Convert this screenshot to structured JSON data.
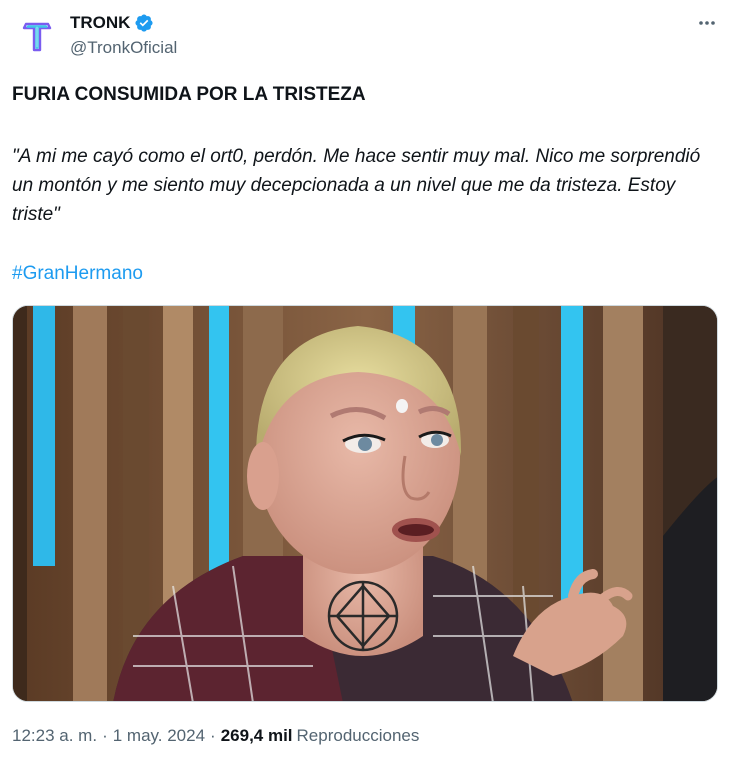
{
  "author": {
    "display_name": "TRONK",
    "handle": "@TronkOficial",
    "avatar_letter": "T",
    "verified": true,
    "verified_color": "#1d9bf0"
  },
  "post": {
    "headline": "FURIA CONSUMIDA POR LA TRISTEZA",
    "quote": "\"A mi me cayó como el ort0, perdón. Me hace sentir muy mal. Nico me sorprendió un montón y me siento muy decepcionada a un nivel que me da tristeza. Estoy triste\"",
    "hashtag": "#GranHermano"
  },
  "meta": {
    "time": "12:23 a. m.",
    "date": "1 may. 2024",
    "views_count": "269,4 mil",
    "views_label": "Reproducciones"
  },
  "colors": {
    "accent": "#1d9bf0",
    "text": "#0f1419",
    "secondary": "#536471",
    "avatar_purple": "#6b5bd6"
  }
}
